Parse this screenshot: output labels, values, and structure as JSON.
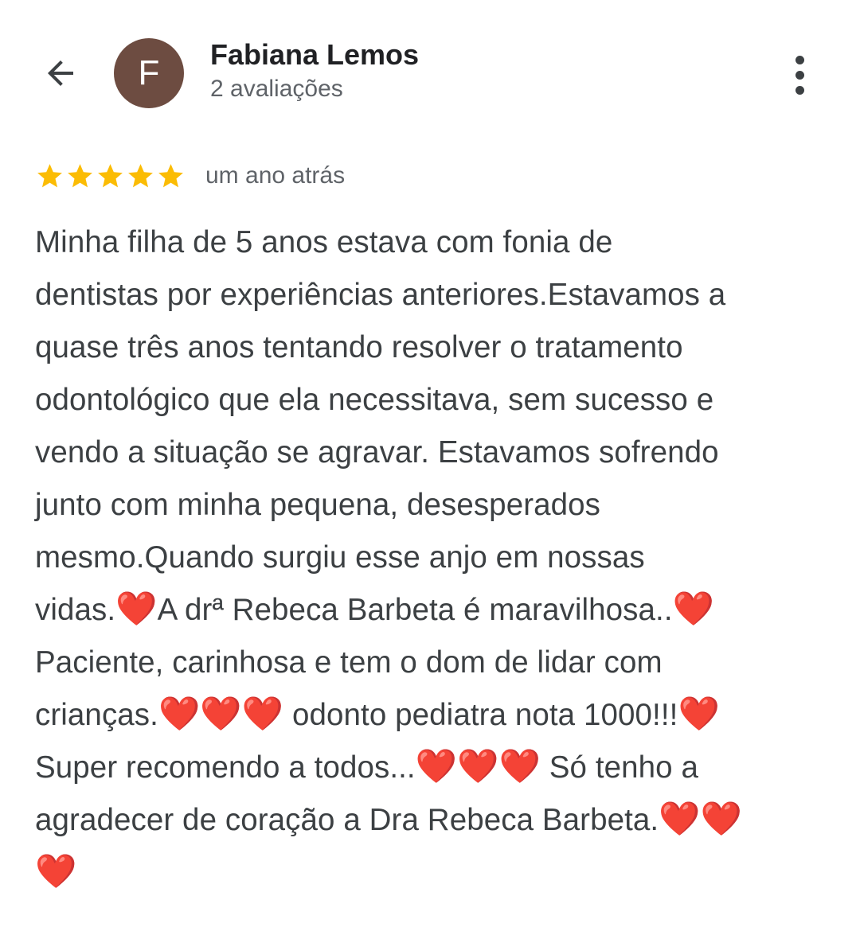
{
  "header": {
    "back_icon": "arrow-back-icon",
    "avatar_letter": "F",
    "avatar_color": "#6d4c41",
    "name": "Fabiana Lemos",
    "review_count": "2 avaliações",
    "more_icon": "more-vert-icon"
  },
  "review": {
    "rating": 5,
    "max_rating": 5,
    "star_color": "#fbbc04",
    "date": "um ano atrás",
    "text": "Minha filha de 5 anos estava com fonia de\ndentistas por experiências anteriores.Estavamos a\nquase três anos tentando resolver o tratamento\nodontológico que ela necessitava, sem sucesso e\nvendo a situação se agravar. Estavamos sofrendo\njunto com minha pequena, desesperados\nmesmo.Quando surgiu esse anjo em nossas\nvidas.❤️A drª Rebeca Barbeta é maravilhosa..❤️\nPaciente, carinhosa e tem o dom de lidar com\ncrianças.❤️❤️❤️ odonto pediatra nota 1000!!!❤️\nSuper recomendo a todos...❤️❤️❤️ Só tenho a\nagradecer de coração a Dra Rebeca Barbeta.❤️❤️\n❤️"
  }
}
